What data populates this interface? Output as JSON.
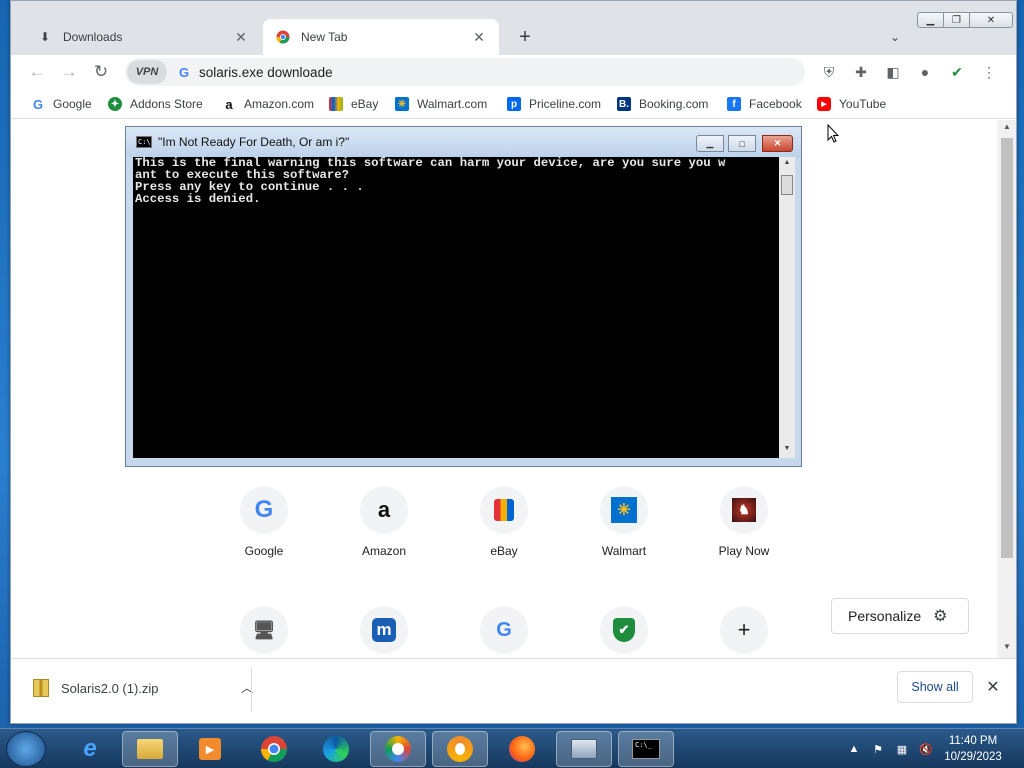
{
  "browser": {
    "tabs": [
      {
        "title": "Downloads",
        "icon": "download-icon",
        "active": false
      },
      {
        "title": "New Tab",
        "icon": "chrome-icon",
        "active": true
      }
    ],
    "new_tab_glyph": "+",
    "omnibox": {
      "vpn_label": "VPN",
      "value": "solaris.exe downloade"
    },
    "bookmarks": [
      {
        "label": "Google",
        "icon": "google-icon",
        "color": "#4285f4"
      },
      {
        "label": "Addons Store",
        "icon": "addons-store-icon",
        "color": "#1e8e3e"
      },
      {
        "label": "Amazon.com",
        "icon": "amazon-icon",
        "color": "#111111"
      },
      {
        "label": "eBay",
        "icon": "ebay-icon",
        "color": "#e53238"
      },
      {
        "label": "Walmart.com",
        "icon": "walmart-icon",
        "color": "#0071ce"
      },
      {
        "label": "Priceline.com",
        "icon": "priceline-icon",
        "color": "#0068ef"
      },
      {
        "label": "Booking.com",
        "icon": "booking-icon",
        "color": "#003580"
      },
      {
        "label": "Facebook",
        "icon": "facebook-icon",
        "color": "#1877f2"
      },
      {
        "label": "YouTube",
        "icon": "youtube-icon",
        "color": "#ff0000"
      }
    ]
  },
  "console": {
    "title": "\"Im Not Ready For Death, Or am i?\"",
    "lines": [
      "This is the final warning this software can harm your device, are you sure you w",
      "ant to execute this software?",
      "Press any key to continue . . .",
      "Access is denied."
    ]
  },
  "new_tab": {
    "shortcuts_row1": [
      {
        "label": "Google",
        "glyph": "G",
        "color": "#4285f4"
      },
      {
        "label": "Amazon",
        "glyph": "a",
        "color": "#111111"
      },
      {
        "label": "eBay",
        "glyph": "🛍",
        "color": "#e53238"
      },
      {
        "label": "Walmart",
        "glyph": "✳",
        "color": "#0071ce"
      },
      {
        "label": "Play Now",
        "glyph": "♞",
        "color": "#8b1a1a"
      }
    ],
    "shortcuts_row2": [
      {
        "label": "",
        "glyph": "🖥",
        "color": "#555555"
      },
      {
        "label": "",
        "glyph": "m",
        "color": "#1a5fb4"
      },
      {
        "label": "",
        "glyph": "G",
        "color": "#4285f4"
      },
      {
        "label": "",
        "glyph": "✔",
        "color": "#1e8e3e"
      },
      {
        "label": "",
        "glyph": "+",
        "color": "#202124"
      }
    ],
    "personalize_label": "Personalize"
  },
  "download_bar": {
    "filename": "Solaris2.0 (1).zip",
    "show_all_label": "Show all"
  },
  "taskbar": {
    "time": "11:40 PM",
    "date": "10/29/2023"
  }
}
